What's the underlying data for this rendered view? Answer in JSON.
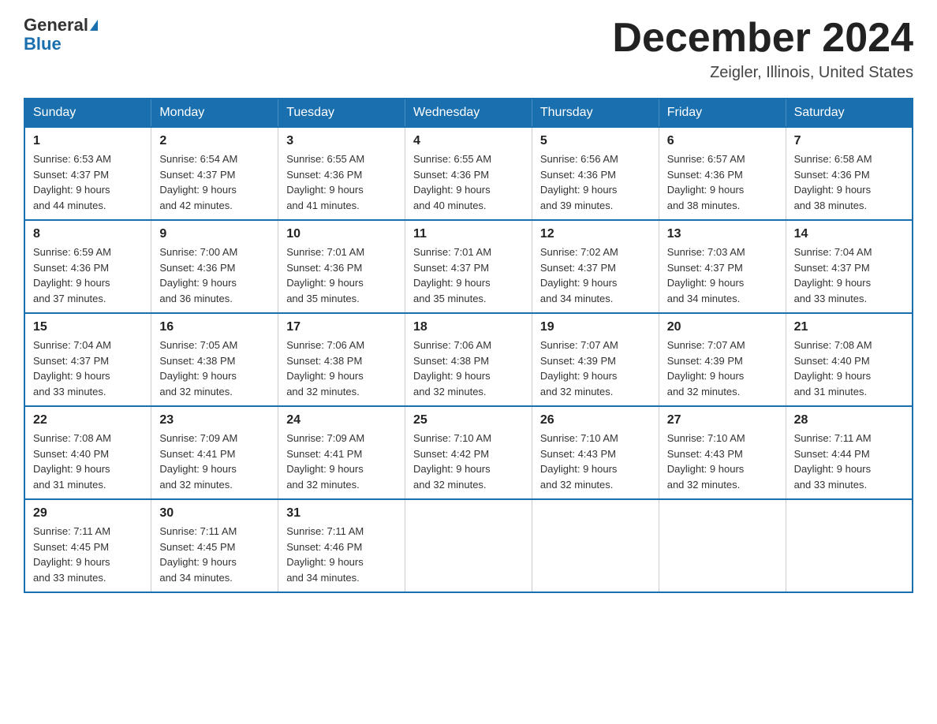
{
  "logo": {
    "general": "General",
    "blue": "Blue"
  },
  "title": {
    "month": "December 2024",
    "location": "Zeigler, Illinois, United States"
  },
  "weekdays": [
    "Sunday",
    "Monday",
    "Tuesday",
    "Wednesday",
    "Thursday",
    "Friday",
    "Saturday"
  ],
  "weeks": [
    [
      {
        "day": "1",
        "sunrise": "6:53 AM",
        "sunset": "4:37 PM",
        "daylight": "9 hours and 44 minutes."
      },
      {
        "day": "2",
        "sunrise": "6:54 AM",
        "sunset": "4:37 PM",
        "daylight": "9 hours and 42 minutes."
      },
      {
        "day": "3",
        "sunrise": "6:55 AM",
        "sunset": "4:36 PM",
        "daylight": "9 hours and 41 minutes."
      },
      {
        "day": "4",
        "sunrise": "6:55 AM",
        "sunset": "4:36 PM",
        "daylight": "9 hours and 40 minutes."
      },
      {
        "day": "5",
        "sunrise": "6:56 AM",
        "sunset": "4:36 PM",
        "daylight": "9 hours and 39 minutes."
      },
      {
        "day": "6",
        "sunrise": "6:57 AM",
        "sunset": "4:36 PM",
        "daylight": "9 hours and 38 minutes."
      },
      {
        "day": "7",
        "sunrise": "6:58 AM",
        "sunset": "4:36 PM",
        "daylight": "9 hours and 38 minutes."
      }
    ],
    [
      {
        "day": "8",
        "sunrise": "6:59 AM",
        "sunset": "4:36 PM",
        "daylight": "9 hours and 37 minutes."
      },
      {
        "day": "9",
        "sunrise": "7:00 AM",
        "sunset": "4:36 PM",
        "daylight": "9 hours and 36 minutes."
      },
      {
        "day": "10",
        "sunrise": "7:01 AM",
        "sunset": "4:36 PM",
        "daylight": "9 hours and 35 minutes."
      },
      {
        "day": "11",
        "sunrise": "7:01 AM",
        "sunset": "4:37 PM",
        "daylight": "9 hours and 35 minutes."
      },
      {
        "day": "12",
        "sunrise": "7:02 AM",
        "sunset": "4:37 PM",
        "daylight": "9 hours and 34 minutes."
      },
      {
        "day": "13",
        "sunrise": "7:03 AM",
        "sunset": "4:37 PM",
        "daylight": "9 hours and 34 minutes."
      },
      {
        "day": "14",
        "sunrise": "7:04 AM",
        "sunset": "4:37 PM",
        "daylight": "9 hours and 33 minutes."
      }
    ],
    [
      {
        "day": "15",
        "sunrise": "7:04 AM",
        "sunset": "4:37 PM",
        "daylight": "9 hours and 33 minutes."
      },
      {
        "day": "16",
        "sunrise": "7:05 AM",
        "sunset": "4:38 PM",
        "daylight": "9 hours and 32 minutes."
      },
      {
        "day": "17",
        "sunrise": "7:06 AM",
        "sunset": "4:38 PM",
        "daylight": "9 hours and 32 minutes."
      },
      {
        "day": "18",
        "sunrise": "7:06 AM",
        "sunset": "4:38 PM",
        "daylight": "9 hours and 32 minutes."
      },
      {
        "day": "19",
        "sunrise": "7:07 AM",
        "sunset": "4:39 PM",
        "daylight": "9 hours and 32 minutes."
      },
      {
        "day": "20",
        "sunrise": "7:07 AM",
        "sunset": "4:39 PM",
        "daylight": "9 hours and 32 minutes."
      },
      {
        "day": "21",
        "sunrise": "7:08 AM",
        "sunset": "4:40 PM",
        "daylight": "9 hours and 31 minutes."
      }
    ],
    [
      {
        "day": "22",
        "sunrise": "7:08 AM",
        "sunset": "4:40 PM",
        "daylight": "9 hours and 31 minutes."
      },
      {
        "day": "23",
        "sunrise": "7:09 AM",
        "sunset": "4:41 PM",
        "daylight": "9 hours and 32 minutes."
      },
      {
        "day": "24",
        "sunrise": "7:09 AM",
        "sunset": "4:41 PM",
        "daylight": "9 hours and 32 minutes."
      },
      {
        "day": "25",
        "sunrise": "7:10 AM",
        "sunset": "4:42 PM",
        "daylight": "9 hours and 32 minutes."
      },
      {
        "day": "26",
        "sunrise": "7:10 AM",
        "sunset": "4:43 PM",
        "daylight": "9 hours and 32 minutes."
      },
      {
        "day": "27",
        "sunrise": "7:10 AM",
        "sunset": "4:43 PM",
        "daylight": "9 hours and 32 minutes."
      },
      {
        "day": "28",
        "sunrise": "7:11 AM",
        "sunset": "4:44 PM",
        "daylight": "9 hours and 33 minutes."
      }
    ],
    [
      {
        "day": "29",
        "sunrise": "7:11 AM",
        "sunset": "4:45 PM",
        "daylight": "9 hours and 33 minutes."
      },
      {
        "day": "30",
        "sunrise": "7:11 AM",
        "sunset": "4:45 PM",
        "daylight": "9 hours and 34 minutes."
      },
      {
        "day": "31",
        "sunrise": "7:11 AM",
        "sunset": "4:46 PM",
        "daylight": "9 hours and 34 minutes."
      },
      null,
      null,
      null,
      null
    ]
  ]
}
